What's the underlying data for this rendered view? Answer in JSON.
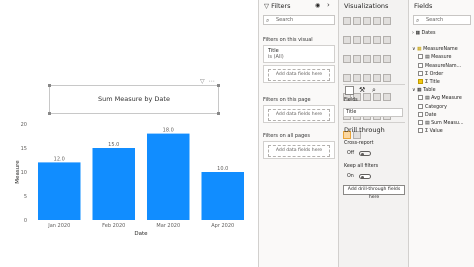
{
  "canvas": {
    "visual_title": "Sum Measure by Date"
  },
  "chart_data": {
    "type": "bar",
    "categories": [
      "Jan 2020",
      "Feb 2020",
      "Mar 2020",
      "Apr 2020"
    ],
    "values": [
      12.0,
      15.0,
      18.0,
      10.0
    ],
    "value_labels": [
      "12.0",
      "15.0",
      "18.0",
      "10.0"
    ],
    "xlabel": "Date",
    "ylabel": "Measure",
    "yticks": [
      "0",
      "5",
      "10",
      "15",
      "20"
    ],
    "ylim": [
      0,
      20
    ],
    "bar_color": "#118dff"
  },
  "filters": {
    "title": "Filters",
    "search_placeholder": "Search",
    "visual_section": "Filters on this visual",
    "visual_card_title": "Title",
    "visual_card_sub": "is (All)",
    "add_fields": "Add data fields here",
    "page_section": "Filters on this page",
    "all_section": "Filters on all pages"
  },
  "viz": {
    "title": "Visualizations",
    "fields_tab": "Fields",
    "well_value": "Title",
    "drill_title": "Drill through",
    "cross_report": "Cross-report",
    "off_label": "Off",
    "keep_filters": "Keep all filters",
    "on_label": "On",
    "add_drill": "Add drill-through fields here"
  },
  "fields": {
    "title": "Fields",
    "search_placeholder": "Search",
    "tables": [
      {
        "name": "Dates",
        "items": []
      },
      {
        "name": "MeasureName",
        "items": [
          {
            "label": "Measure",
            "checked": false
          },
          {
            "label": "MeasureNam...",
            "checked": false
          },
          {
            "label": "Order",
            "checked": false
          },
          {
            "label": "Title",
            "checked": true
          }
        ]
      },
      {
        "name": "Table",
        "items": [
          {
            "label": "Avg Measure",
            "checked": false
          },
          {
            "label": "Category",
            "checked": false
          },
          {
            "label": "Date",
            "checked": false
          },
          {
            "label": "Sum Measu...",
            "checked": false
          },
          {
            "label": "Value",
            "checked": false
          }
        ]
      }
    ]
  }
}
